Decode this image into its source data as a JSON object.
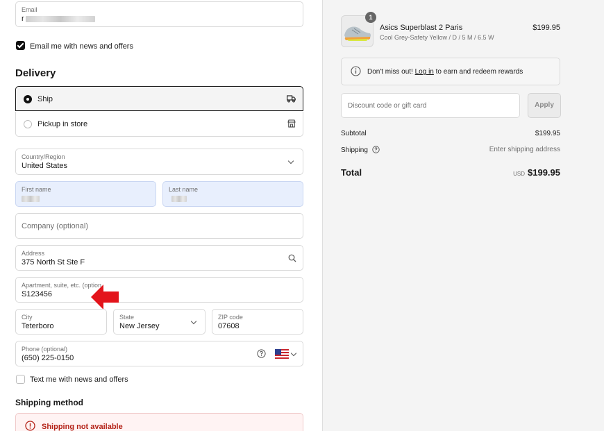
{
  "contact": {
    "email_label": "Email",
    "email_value_initial": "r",
    "newsletter_label": "Email me with news and offers",
    "newsletter_checked": true
  },
  "delivery": {
    "heading": "Delivery",
    "options": [
      {
        "label": "Ship",
        "selected": true,
        "icon": "truck-icon"
      },
      {
        "label": "Pickup in store",
        "selected": false,
        "icon": "store-icon"
      }
    ],
    "country_label": "Country/Region",
    "country_value": "United States",
    "first_name_label": "First name",
    "last_name_label": "Last name",
    "company_placeholder": "Company (optional)",
    "address_label": "Address",
    "address_value": "375 North St Ste F",
    "apartment_label": "Apartment, suite, etc. (option",
    "apartment_value": "S123456",
    "city_label": "City",
    "city_value": "Teterboro",
    "state_label": "State",
    "state_value": "New Jersey",
    "zip_label": "ZIP code",
    "zip_value": "07608",
    "phone_label": "Phone (optional)",
    "phone_value": "(650) 225-0150",
    "sms_label": "Text me with news and offers",
    "sms_checked": false
  },
  "shipping_method": {
    "heading": "Shipping method",
    "error": "Shipping not available"
  },
  "order": {
    "quantity": "1",
    "product_name": "Asics Superblast 2 Paris",
    "product_variant": "Cool Grey-Safety Yellow / D / 5 M / 6.5 W",
    "product_price": "$199.95",
    "promo_prefix": "Don't miss out! ",
    "promo_link": "Log in",
    "promo_suffix": " to earn and redeem rewards",
    "discount_placeholder": "Discount code or gift card",
    "apply_label": "Apply",
    "subtotal_label": "Subtotal",
    "subtotal_value": "$199.95",
    "shipping_label": "Shipping",
    "shipping_value": "Enter shipping address",
    "total_label": "Total",
    "total_currency": "USD",
    "total_value": "$199.95"
  },
  "colors": {
    "accent": "#111111",
    "error": "#b42318",
    "annotation_arrow": "#e3141b",
    "autofill": "#e8effd"
  }
}
